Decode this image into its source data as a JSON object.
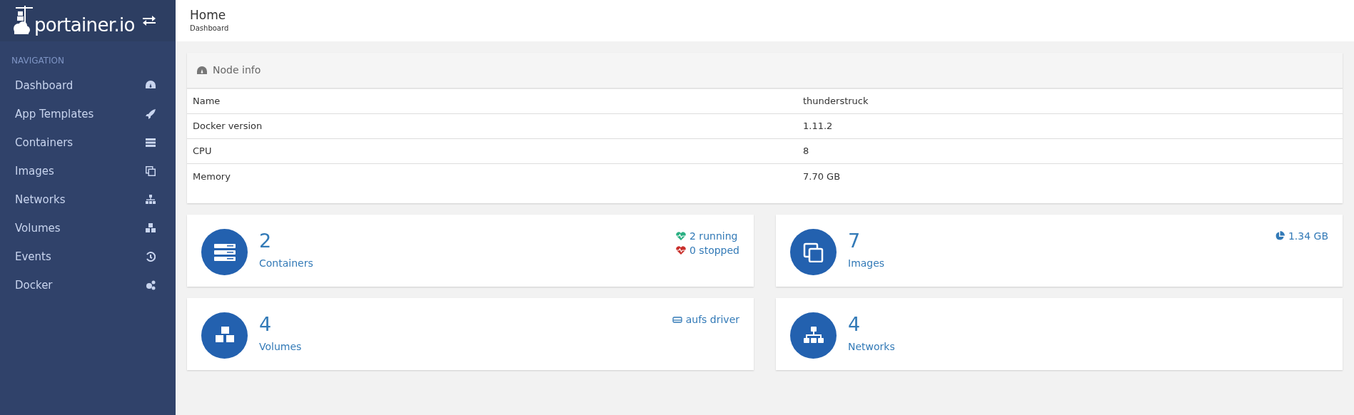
{
  "brand": {
    "logo": "portainer.io"
  },
  "sidebar": {
    "heading": "NAVIGATION",
    "items": [
      {
        "label": "Dashboard"
      },
      {
        "label": "App Templates"
      },
      {
        "label": "Containers"
      },
      {
        "label": "Images"
      },
      {
        "label": "Networks"
      },
      {
        "label": "Volumes"
      },
      {
        "label": "Events"
      },
      {
        "label": "Docker"
      }
    ]
  },
  "header": {
    "title": "Home",
    "breadcrumb": "Dashboard"
  },
  "node_info": {
    "title": "Node info",
    "rows": [
      {
        "label": "Name",
        "value": "thunderstruck"
      },
      {
        "label": "Docker version",
        "value": "1.11.2"
      },
      {
        "label": "CPU",
        "value": "8"
      },
      {
        "label": "Memory",
        "value": "7.70 GB"
      }
    ]
  },
  "cards": [
    {
      "count": "2",
      "label": "Containers",
      "stats": [
        {
          "kind": "healthy",
          "text": "2 running"
        },
        {
          "kind": "unhealthy",
          "text": "0 stopped"
        }
      ]
    },
    {
      "count": "7",
      "label": "Images",
      "stats": [
        {
          "kind": "size",
          "text": "1.34 GB"
        }
      ]
    },
    {
      "count": "4",
      "label": "Volumes",
      "stats": [
        {
          "kind": "driver",
          "text": "aufs driver"
        }
      ]
    },
    {
      "count": "4",
      "label": "Networks"
    }
  ]
}
